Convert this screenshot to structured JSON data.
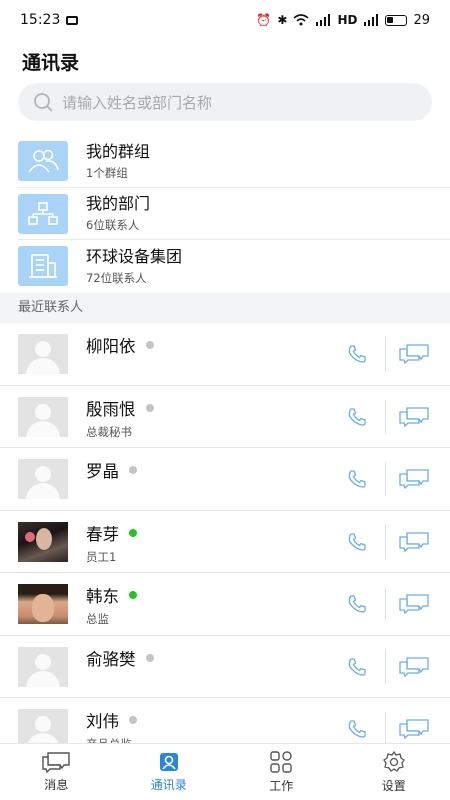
{
  "status": {
    "time": "15:23",
    "network": "HD",
    "battery": "29"
  },
  "page": {
    "title": "通讯录"
  },
  "search": {
    "placeholder": "请输入姓名或部门名称"
  },
  "groups": [
    {
      "title": "我的群组",
      "sub": "1个群组",
      "icon": "group-icon"
    },
    {
      "title": "我的部门",
      "sub": "6位联系人",
      "icon": "org-chart-icon"
    },
    {
      "title": "环球设备集团",
      "sub": "72位联系人",
      "icon": "building-icon"
    }
  ],
  "recent": {
    "header": "最近联系人",
    "contacts": [
      {
        "name": "柳阳依",
        "title": "",
        "online": false,
        "avatar": "placeholder"
      },
      {
        "name": "殷雨恨",
        "title": "总裁秘书",
        "online": false,
        "avatar": "placeholder"
      },
      {
        "name": "罗晶",
        "title": "",
        "online": false,
        "avatar": "placeholder"
      },
      {
        "name": "春芽",
        "title": "员工1",
        "online": true,
        "avatar": "photo-a"
      },
      {
        "name": "韩东",
        "title": "总监",
        "online": true,
        "avatar": "photo-b"
      },
      {
        "name": "俞骆樊",
        "title": "",
        "online": false,
        "avatar": "placeholder"
      },
      {
        "name": "刘伟",
        "title": "产品总监",
        "online": false,
        "avatar": "placeholder"
      }
    ]
  },
  "tabs": [
    {
      "label": "消息",
      "icon": "chat-icon",
      "active": false
    },
    {
      "label": "通讯录",
      "icon": "contacts-icon",
      "active": true
    },
    {
      "label": "工作",
      "icon": "apps-grid-icon",
      "active": false
    },
    {
      "label": "设置",
      "icon": "gear-icon",
      "active": false
    }
  ],
  "colors": {
    "accent": "#2a86d6",
    "icon_blue": "#6aaee8",
    "tile_blue": "#a9d3f7",
    "online": "#22c522",
    "offline": "#c4c4c4"
  }
}
